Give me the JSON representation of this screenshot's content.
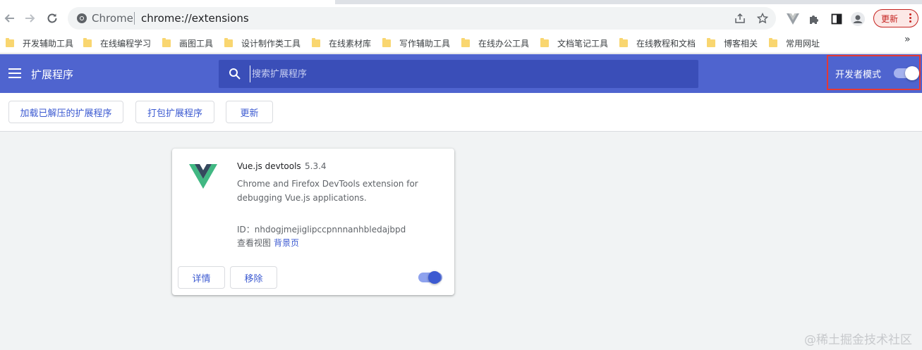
{
  "browser": {
    "omnibox_label": "Chrome",
    "url": "chrome://extensions",
    "update_label": "更新"
  },
  "bookmarks": [
    {
      "label": "开发辅助工具"
    },
    {
      "label": "在线编程学习"
    },
    {
      "label": "画图工具"
    },
    {
      "label": "设计制作类工具"
    },
    {
      "label": "在线素材库"
    },
    {
      "label": "写作辅助工具"
    },
    {
      "label": "在线办公工具"
    },
    {
      "label": "文档笔记工具"
    },
    {
      "label": "在线教程和文档"
    },
    {
      "label": "博客相关"
    },
    {
      "label": "常用网址"
    }
  ],
  "bookmarks_overflow": "»",
  "header": {
    "title": "扩展程序",
    "search_placeholder": "搜索扩展程序",
    "dev_mode_label": "开发者模式",
    "dev_mode_enabled": true
  },
  "actions": {
    "load_unpacked": "加载已解压的扩展程序",
    "pack": "打包扩展程序",
    "update": "更新"
  },
  "extension": {
    "name": "Vue.js devtools",
    "version": "5.3.4",
    "description": "Chrome and Firefox DevTools extension for debugging Vue.js applications.",
    "id_label": "ID：",
    "id": "nhdogjmejiglipccpnnnanhbledajbpd",
    "views_label": "查看视图",
    "views_link": "背景页",
    "details_label": "详情",
    "remove_label": "移除",
    "enabled": true
  },
  "watermark": "@稀土掘金技术社区",
  "colors": {
    "header_bg": "#4f64cf",
    "accent": "#3c5ad1",
    "highlight_border": "#e53935",
    "vue_green": "#41b883",
    "vue_dark": "#35495e"
  }
}
